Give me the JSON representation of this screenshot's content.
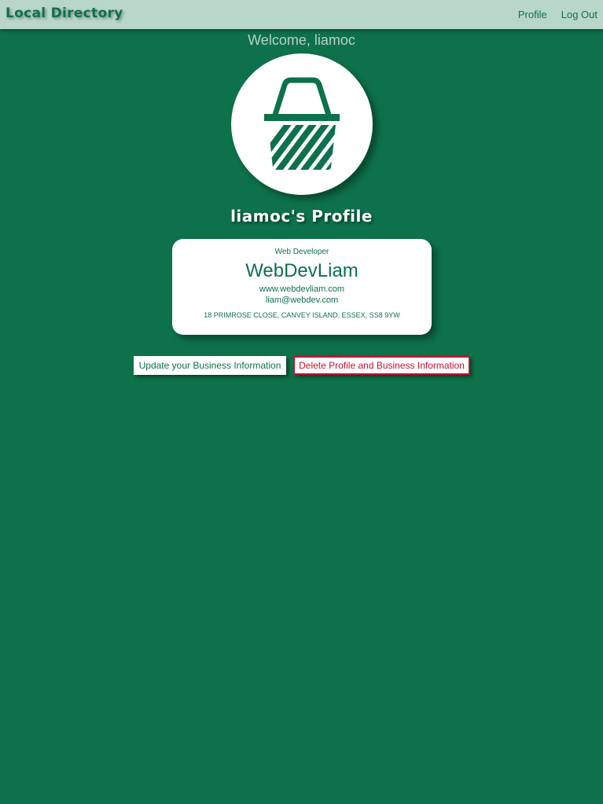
{
  "navbar": {
    "brand": "Local Directory",
    "links": [
      {
        "label": "Profile"
      },
      {
        "label": "Log Out"
      }
    ]
  },
  "welcome": "Welcome, liamoc",
  "avatar": {
    "icon": "shopping-basket-icon"
  },
  "profile_title": "liamoc's Profile",
  "card": {
    "job_title": "Web Developer",
    "business_name": "WebDevLiam",
    "website": "www.webdevliam.com",
    "email": "liam@webdev.com",
    "address": "18 PRIMROSE CLOSE, CANVEY ISLAND, ESSEX, SS8 9YW"
  },
  "buttons": {
    "update": "Update your Business Information",
    "delete": "Delete Profile and Business Information"
  },
  "colors": {
    "background": "#0d7149",
    "navbar": "#b9d6cb",
    "danger": "#c8102e"
  }
}
